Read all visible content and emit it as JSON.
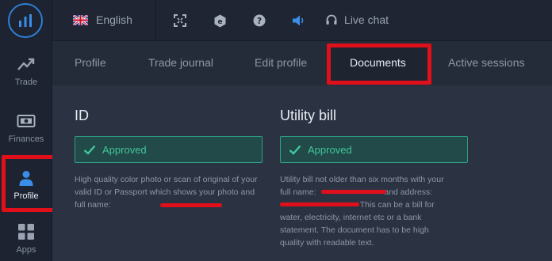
{
  "app": {
    "language": "English",
    "live_chat": "Live chat"
  },
  "sidebar": {
    "items": [
      {
        "label": "Trade",
        "icon": "trending-up-icon"
      },
      {
        "label": "Finances",
        "icon": "banknote-icon"
      },
      {
        "label": "Profile",
        "icon": "user-icon"
      },
      {
        "label": "Apps",
        "icon": "grid-icon"
      }
    ]
  },
  "tabs": [
    {
      "label": "Profile"
    },
    {
      "label": "Trade journal"
    },
    {
      "label": "Edit profile"
    },
    {
      "label": "Documents"
    },
    {
      "label": "Active sessions"
    }
  ],
  "documents": {
    "id": {
      "title": "ID",
      "status": "Approved",
      "description": "High quality color photo or scan of original of your valid ID or Passport which shows your photo and full name:"
    },
    "utility_bill": {
      "title": "Utility bill",
      "status": "Approved",
      "description_line1": "Utility bill not older than six months with your",
      "description_line2a": "full name:",
      "description_line2b": "and address:",
      "description_line3": "This can be a bill for",
      "description_line4": "water, electricity, internet etc or a bank",
      "description_line5": "statement. The document has to be high",
      "description_line6": "quality with readable text."
    }
  },
  "colors": {
    "highlight": "#e0101a",
    "approved": "#43c59a",
    "accent": "#2f7fd6"
  }
}
